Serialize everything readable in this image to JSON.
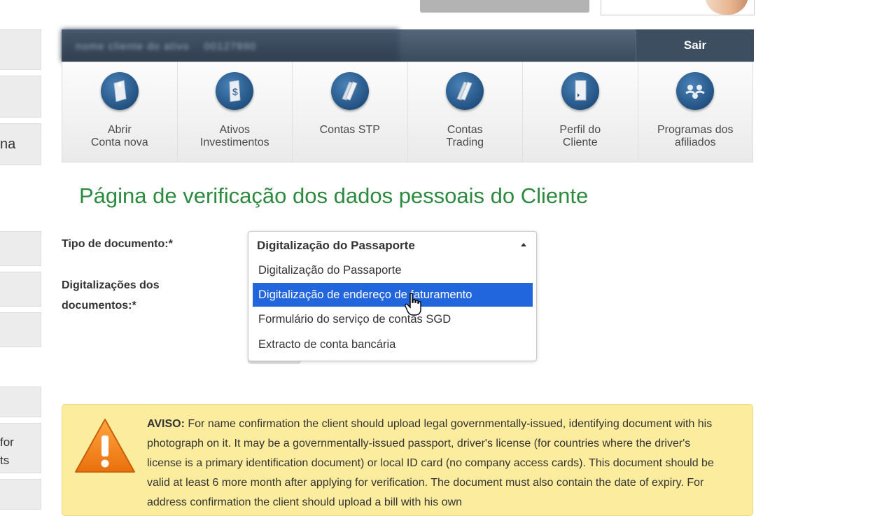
{
  "header": {
    "user_name_blurred": "nome cliente do ativo",
    "user_id_blurred": "00127890",
    "logout_label": "Sair"
  },
  "left_sidebar": {
    "items": [
      "",
      "",
      "na",
      "",
      "",
      "",
      "",
      "for\nts",
      ""
    ]
  },
  "menu": {
    "items": [
      {
        "label": "Abrir\nConta nova",
        "icon": "open-account-icon"
      },
      {
        "label": "Ativos\nInvestimentos",
        "icon": "investments-icon"
      },
      {
        "label": "Contas STP",
        "icon": "stp-accounts-icon"
      },
      {
        "label": "Contas\nTrading",
        "icon": "trading-accounts-icon"
      },
      {
        "label": "Perfil do\nCliente",
        "icon": "client-profile-icon"
      },
      {
        "label": "Programas dos\nafiliados",
        "icon": "affiliates-icon"
      }
    ]
  },
  "page": {
    "title": "Página de verificação dos dados pessoais do Cliente"
  },
  "form": {
    "doc_type_label": "Tipo de documento:*",
    "doc_scans_label": "Digitalizações dos\ndocumentos:*",
    "select": {
      "selected": "Digitalização do Passaporte",
      "options": [
        "Digitalização do Passaporte",
        "Digitalização de endereço de faturamento",
        "Formulário do serviço de contas SGD",
        "Extracto de conta bancária"
      ],
      "highlighted_index": 1
    }
  },
  "warning": {
    "title": "AVISO:",
    "text": " For name confirmation the client should upload legal governmentally-issued, identifying document with his photograph on it. It may be a governmentally-issued passport, driver's license (for countries where the driver's license is a primary identification document) or local ID card (no company access cards). This document should be valid at least 6 more month after applying for verification. The document must also contain the date of expiry. For address confirmation the client should upload a bill with his own"
  },
  "colors": {
    "title_green": "#2b8a3e",
    "nav_dark": "#3a4b5d",
    "highlight_blue": "#2266dd",
    "warning_bg": "#fcec9e"
  }
}
